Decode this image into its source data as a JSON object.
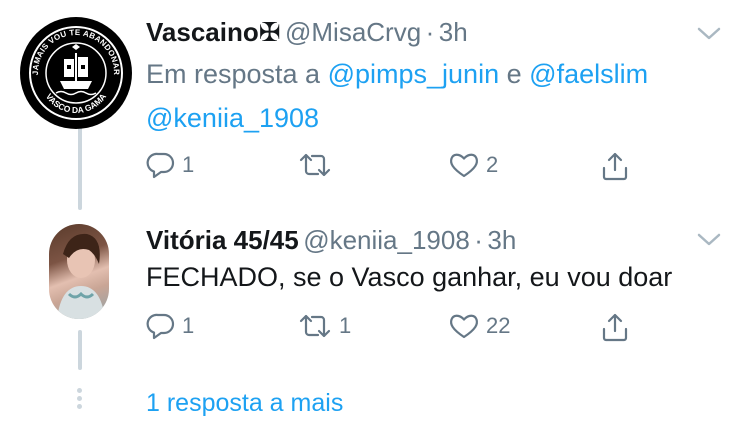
{
  "tweet1": {
    "name": "Vascaino✠",
    "handle": "@MisaCrvg",
    "sep": "·",
    "time": "3h",
    "reply_prefix": "Em resposta a",
    "reply_user1": "@pimps_junin",
    "reply_conj": "e",
    "reply_user2": "@faelslim",
    "reply_user3": "@keniia_1908",
    "actions": {
      "reply_count": "1",
      "retweet_count": "",
      "like_count": "2"
    },
    "avatar_logo": {
      "top": "JAMAIS VOU TE ABANDONAR",
      "bottom": "VASCO DA GAMA"
    }
  },
  "tweet2": {
    "name": "Vitória 45/45",
    "handle": "@keniia_1908",
    "sep": "·",
    "time": "3h",
    "text": "FECHADO, se o Vasco ganhar, eu vou doar",
    "actions": {
      "reply_count": "1",
      "retweet_count": "1",
      "like_count": "22"
    }
  },
  "more_replies": "1 resposta a mais",
  "colors": {
    "link": "#1da1f2",
    "muted": "#657786",
    "thread": "#ccd6dd"
  },
  "icons": [
    "reply-icon",
    "retweet-icon",
    "like-icon",
    "share-icon",
    "chevron-down-icon"
  ]
}
